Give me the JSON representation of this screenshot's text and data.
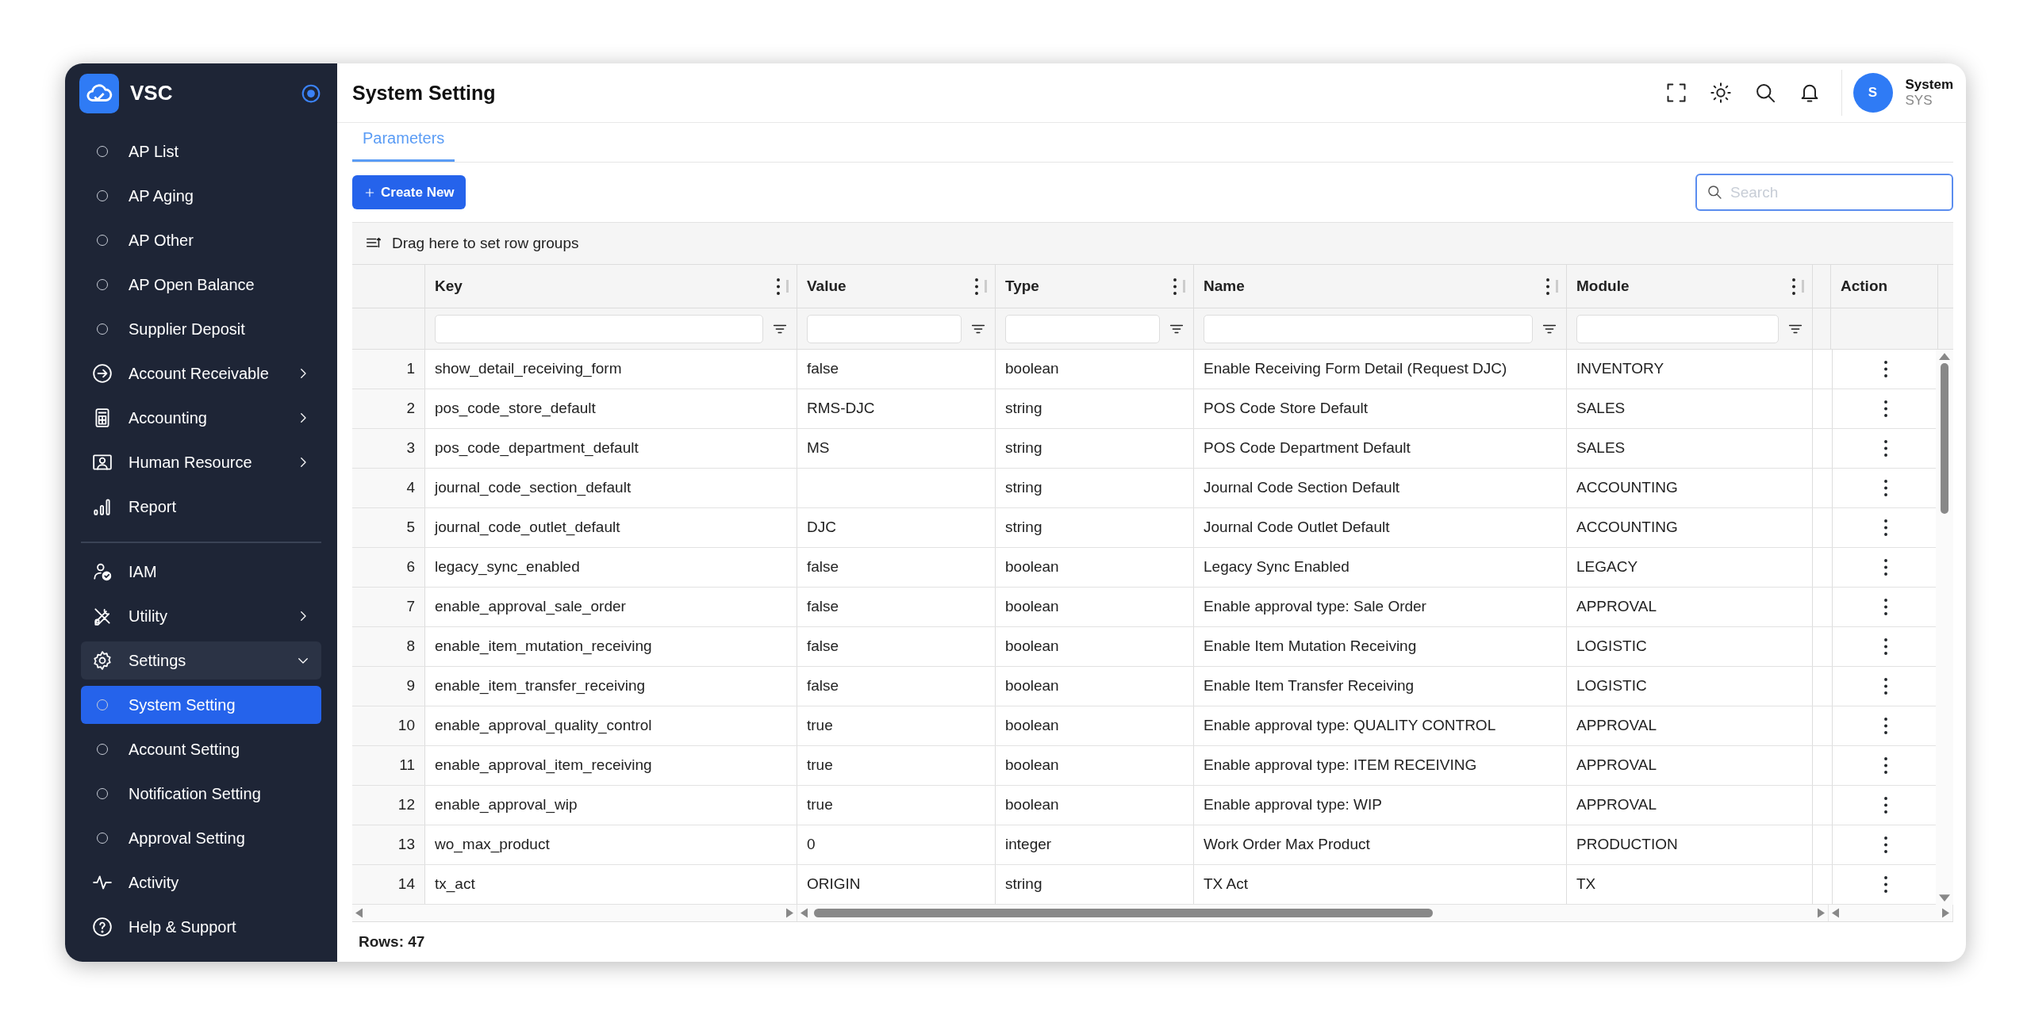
{
  "app": {
    "name": "VSC"
  },
  "sidebar": {
    "sections": [
      {
        "items": [
          {
            "label": "AP List",
            "kind": "sub",
            "selected": false
          },
          {
            "label": "AP Aging",
            "kind": "sub",
            "selected": false
          },
          {
            "label": "AP Other",
            "kind": "sub",
            "selected": false
          },
          {
            "label": "AP Open Balance",
            "kind": "sub",
            "selected": false
          },
          {
            "label": "Supplier Deposit",
            "kind": "sub",
            "selected": false
          },
          {
            "label": "Account Receivable",
            "kind": "group",
            "expanded": false,
            "selected": false
          },
          {
            "label": "Accounting",
            "kind": "group",
            "expanded": false,
            "selected": false
          },
          {
            "label": "Human Resource",
            "kind": "group",
            "expanded": false,
            "selected": false
          },
          {
            "label": "Report",
            "kind": "link",
            "selected": false
          }
        ]
      },
      {
        "items": [
          {
            "label": "IAM",
            "kind": "link",
            "selected": false
          },
          {
            "label": "Utility",
            "kind": "group",
            "expanded": false,
            "selected": false
          },
          {
            "label": "Settings",
            "kind": "group",
            "expanded": true,
            "selected": false,
            "children": [
              {
                "label": "System Setting",
                "kind": "sub",
                "selected": true
              },
              {
                "label": "Account Setting",
                "kind": "sub",
                "selected": false
              },
              {
                "label": "Notification Setting",
                "kind": "sub",
                "selected": false
              },
              {
                "label": "Approval Setting",
                "kind": "sub",
                "selected": false
              }
            ]
          },
          {
            "label": "Activity",
            "kind": "link",
            "selected": false
          },
          {
            "label": "Help & Support",
            "kind": "link",
            "selected": false
          }
        ]
      }
    ]
  },
  "header": {
    "title": "System Setting",
    "user": {
      "avatar": "S",
      "name": "System",
      "role": "SYS"
    }
  },
  "tabs": [
    {
      "label": "Parameters",
      "selected": true
    }
  ],
  "toolbar": {
    "create_button": "Create New",
    "search": {
      "placeholder": "Search"
    }
  },
  "grid": {
    "group_panel": "Drag here to set row groups",
    "columns": [
      {
        "label": "Key",
        "kind": "data"
      },
      {
        "label": "Value",
        "kind": "data"
      },
      {
        "label": "Type",
        "kind": "data"
      },
      {
        "label": "Name",
        "kind": "data"
      },
      {
        "label": "Module",
        "kind": "data"
      },
      {
        "label": "Action",
        "kind": "action"
      }
    ],
    "rows": [
      {
        "number": "1",
        "key": "show_detail_receiving_form",
        "value": "false",
        "type": "boolean",
        "name": "Enable Receiving Form Detail (Request DJC)",
        "module": "INVENTORY"
      },
      {
        "number": "2",
        "key": "pos_code_store_default",
        "value": "RMS-DJC",
        "type": "string",
        "name": "POS Code Store Default",
        "module": "SALES"
      },
      {
        "number": "3",
        "key": "pos_code_department_default",
        "value": "MS",
        "type": "string",
        "name": "POS Code Department Default",
        "module": "SALES"
      },
      {
        "number": "4",
        "key": "journal_code_section_default",
        "type": "string",
        "name": "Journal Code Section Default",
        "module": "ACCOUNTING"
      },
      {
        "number": "5",
        "key": "journal_code_outlet_default",
        "value": "DJC",
        "type": "string",
        "name": "Journal Code Outlet Default",
        "module": "ACCOUNTING"
      },
      {
        "number": "6",
        "key": "legacy_sync_enabled",
        "value": "false",
        "type": "boolean",
        "name": "Legacy Sync Enabled",
        "module": "LEGACY"
      },
      {
        "number": "7",
        "key": "enable_approval_sale_order",
        "value": "false",
        "type": "boolean",
        "name": "Enable approval type: Sale Order",
        "module": "APPROVAL"
      },
      {
        "number": "8",
        "key": "enable_item_mutation_receiving",
        "value": "false",
        "type": "boolean",
        "name": "Enable Item Mutation Receiving",
        "module": "LOGISTIC"
      },
      {
        "number": "9",
        "key": "enable_item_transfer_receiving",
        "value": "false",
        "type": "boolean",
        "name": "Enable Item Transfer Receiving",
        "module": "LOGISTIC"
      },
      {
        "number": "10",
        "key": "enable_approval_quality_control",
        "value": "true",
        "type": "boolean",
        "name": "Enable approval type: QUALITY CONTROL",
        "module": "APPROVAL"
      },
      {
        "number": "11",
        "key": "enable_approval_item_receiving",
        "value": "true",
        "type": "boolean",
        "name": "Enable approval type: ITEM RECEIVING",
        "module": "APPROVAL"
      },
      {
        "number": "12",
        "key": "enable_approval_wip",
        "value": "true",
        "type": "boolean",
        "name": "Enable approval type: WIP",
        "module": "APPROVAL"
      },
      {
        "number": "13",
        "key": "wo_max_product",
        "value": "0",
        "type": "integer",
        "name": "Work Order Max Product",
        "module": "PRODUCTION"
      },
      {
        "number": "14",
        "key": "tx_act",
        "value": "ORIGIN",
        "type": "string",
        "name": "TX Act",
        "module": "TX"
      }
    ],
    "footer": "Rows: 47"
  }
}
